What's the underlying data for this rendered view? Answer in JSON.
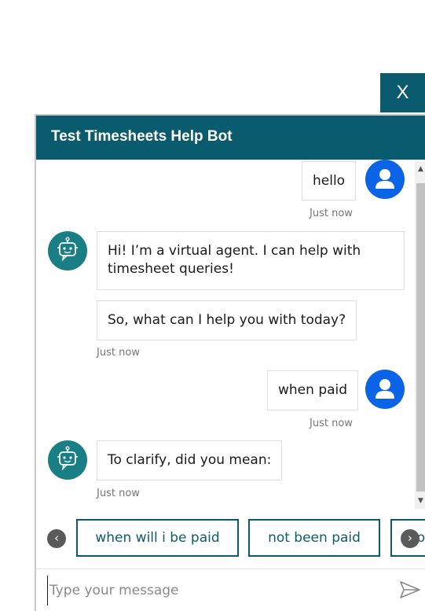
{
  "close_button": {
    "label": "X"
  },
  "header": {
    "title": "Test Timesheets Help Bot"
  },
  "messages": {
    "m1": {
      "text": "hello",
      "time": "Just now"
    },
    "m2": {
      "line1": "Hi! I’m a virtual agent. I can help with",
      "line2": "timesheet queries!"
    },
    "m3": {
      "text": "So, what can I help you with today?",
      "time": "Just now"
    },
    "m4": {
      "text": "when paid",
      "time": "Just now"
    },
    "m5": {
      "text": "To clarify, did you mean:",
      "time": "Just now"
    }
  },
  "suggestions": {
    "items": [
      {
        "label": "when will i be paid"
      },
      {
        "label": "not been paid"
      },
      {
        "label": "no"
      }
    ],
    "prev_symbol": "‹",
    "next_symbol": "›"
  },
  "composer": {
    "placeholder": "Type your message"
  },
  "scrollbar": {
    "up_symbol": "▲",
    "down_symbol": "▼"
  },
  "colors": {
    "brand": "#0b5b6e",
    "user_avatar": "#0b63e5",
    "bot_avatar": "#1a7f84",
    "timestamp": "#767676"
  },
  "icons": {
    "user_avatar": "person-icon",
    "bot_avatar": "robot-icon",
    "send": "send-icon"
  }
}
